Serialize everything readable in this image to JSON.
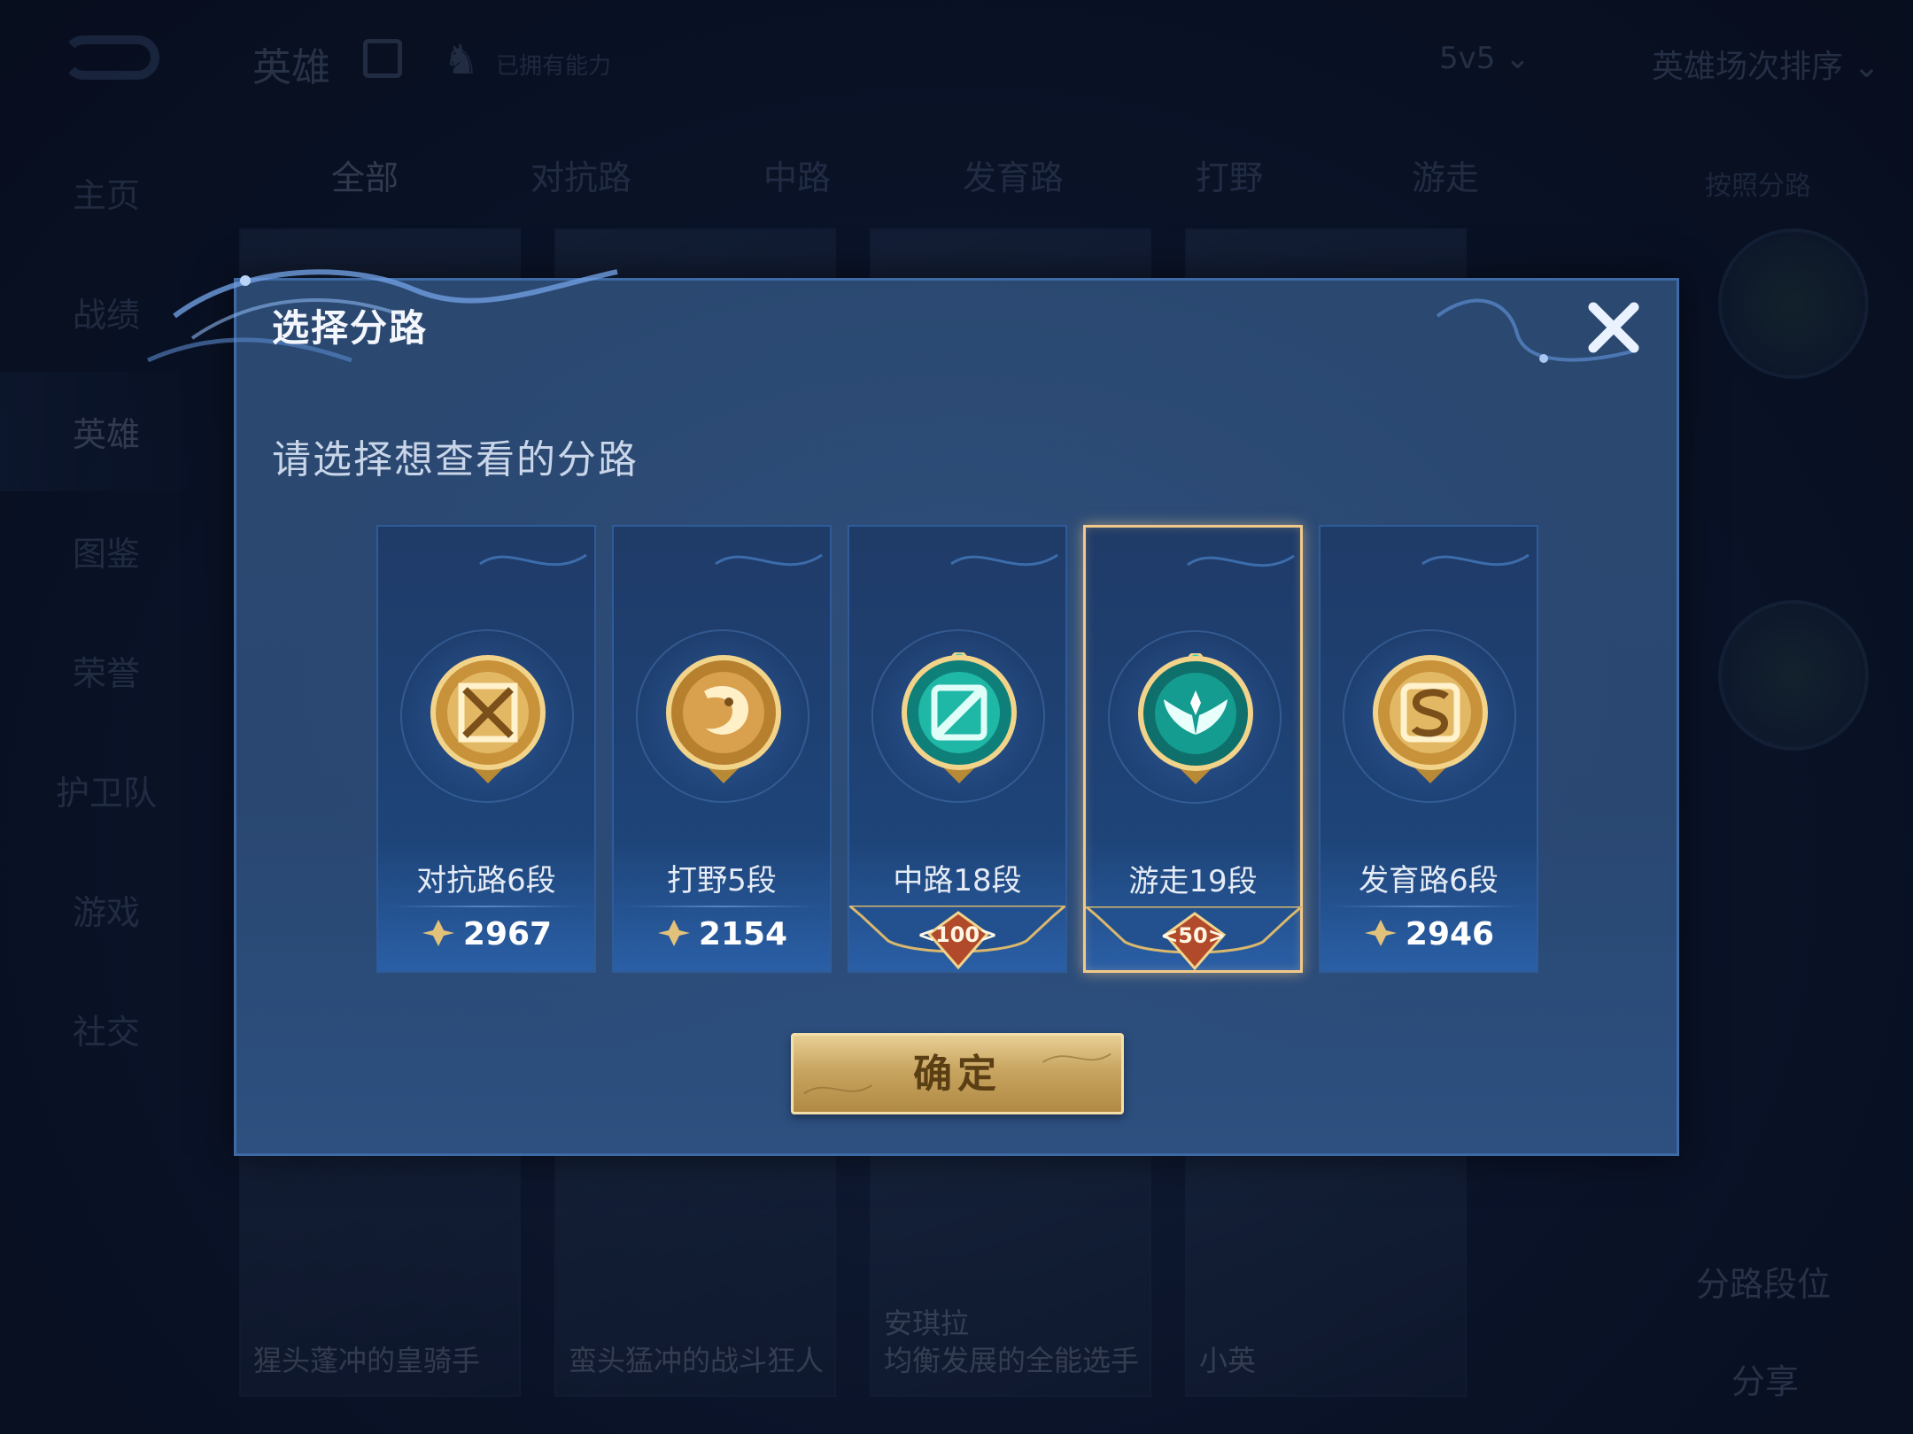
{
  "background": {
    "app_title": "英雄",
    "top_note": "已拥有能力",
    "mode": "5v5",
    "sort": "英雄场次排序",
    "nav": [
      "主页",
      "战绩",
      "英雄",
      "图鉴",
      "荣誉",
      "护卫队",
      "游戏",
      "社交"
    ],
    "categories": [
      "全部",
      "对抗路",
      "中路",
      "发育路",
      "打野",
      "游走"
    ],
    "filter": "按照分路",
    "hero_captions": [
      "猩头蓬冲的皇骑手",
      "蛮头猛冲的战斗狂人",
      "安琪拉\n均衡发展的全能选手",
      "小英"
    ],
    "right_labels": [
      "分路段位",
      "分享"
    ]
  },
  "dialog": {
    "title": "选择分路",
    "subtitle": "请选择想查看的分路",
    "confirm_label": "确定"
  },
  "lanes": [
    {
      "name": "对抗路6段",
      "score": "2967",
      "emblem": "gold-crossed-swords-emblem",
      "selected": false
    },
    {
      "name": "打野5段",
      "score": "2154",
      "emblem": "gold-dragon-emblem",
      "selected": false
    },
    {
      "name": "中路18段",
      "badge": "100",
      "emblem": "teal-slash-emblem",
      "selected": false
    },
    {
      "name": "游走19段",
      "badge": "50",
      "emblem": "teal-wings-emblem",
      "selected": true
    },
    {
      "name": "发育路6段",
      "score": "2946",
      "emblem": "gold-s-emblem",
      "selected": false
    }
  ],
  "colors": {
    "dialog_bg": "#294771",
    "selected_border": "#f1c98a",
    "confirm_gold": "#c8a560",
    "gold_emblem": "#d9a84a",
    "teal_emblem": "#1fb7a6"
  }
}
